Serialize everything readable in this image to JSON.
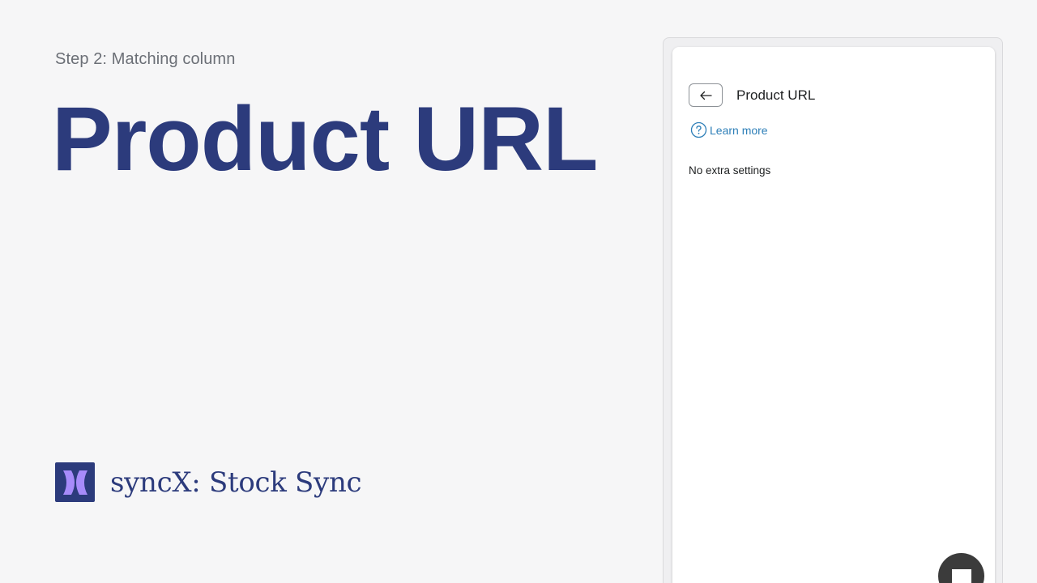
{
  "step": {
    "label": "Step 2: Matching column"
  },
  "hero": {
    "title": "Product URL"
  },
  "brand": {
    "name": "syncX: Stock Sync",
    "logo_icon": "syncx-logo-icon",
    "color": "#2c3b7c",
    "accent": "#a78bfa"
  },
  "panel": {
    "back_icon": "arrow-left-icon",
    "title": "Product URL",
    "learn_more_icon": "question-circle-icon",
    "learn_more_label": "Learn more",
    "no_settings_text": "No extra settings"
  },
  "chat": {
    "icon": "chat-icon"
  }
}
